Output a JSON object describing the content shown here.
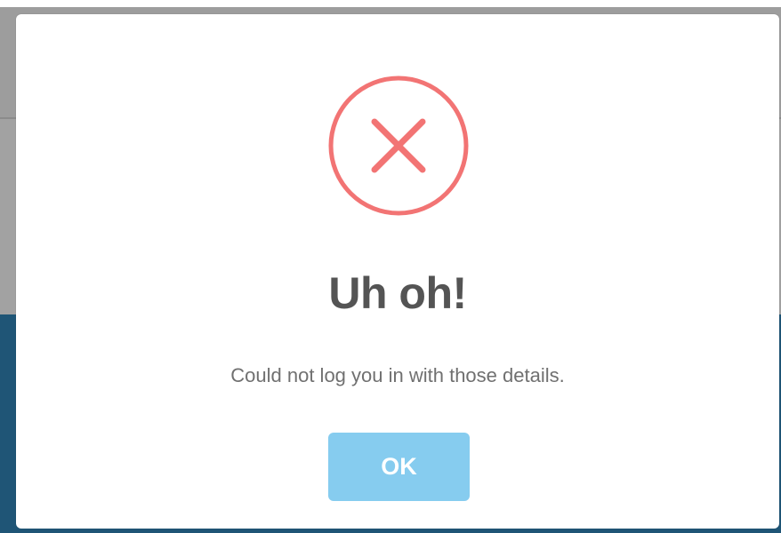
{
  "dialog": {
    "icon": "error-x-circle-icon",
    "title": "Uh oh!",
    "message": "Could not log you in with those details.",
    "ok_label": "OK"
  },
  "colors": {
    "error_red": "#f27474",
    "title_gray": "#545454",
    "message_gray": "#707070",
    "button_blue": "#86ccef",
    "backdrop_gray": "#9d9d9d",
    "backdrop_blue": "#1f5576"
  }
}
